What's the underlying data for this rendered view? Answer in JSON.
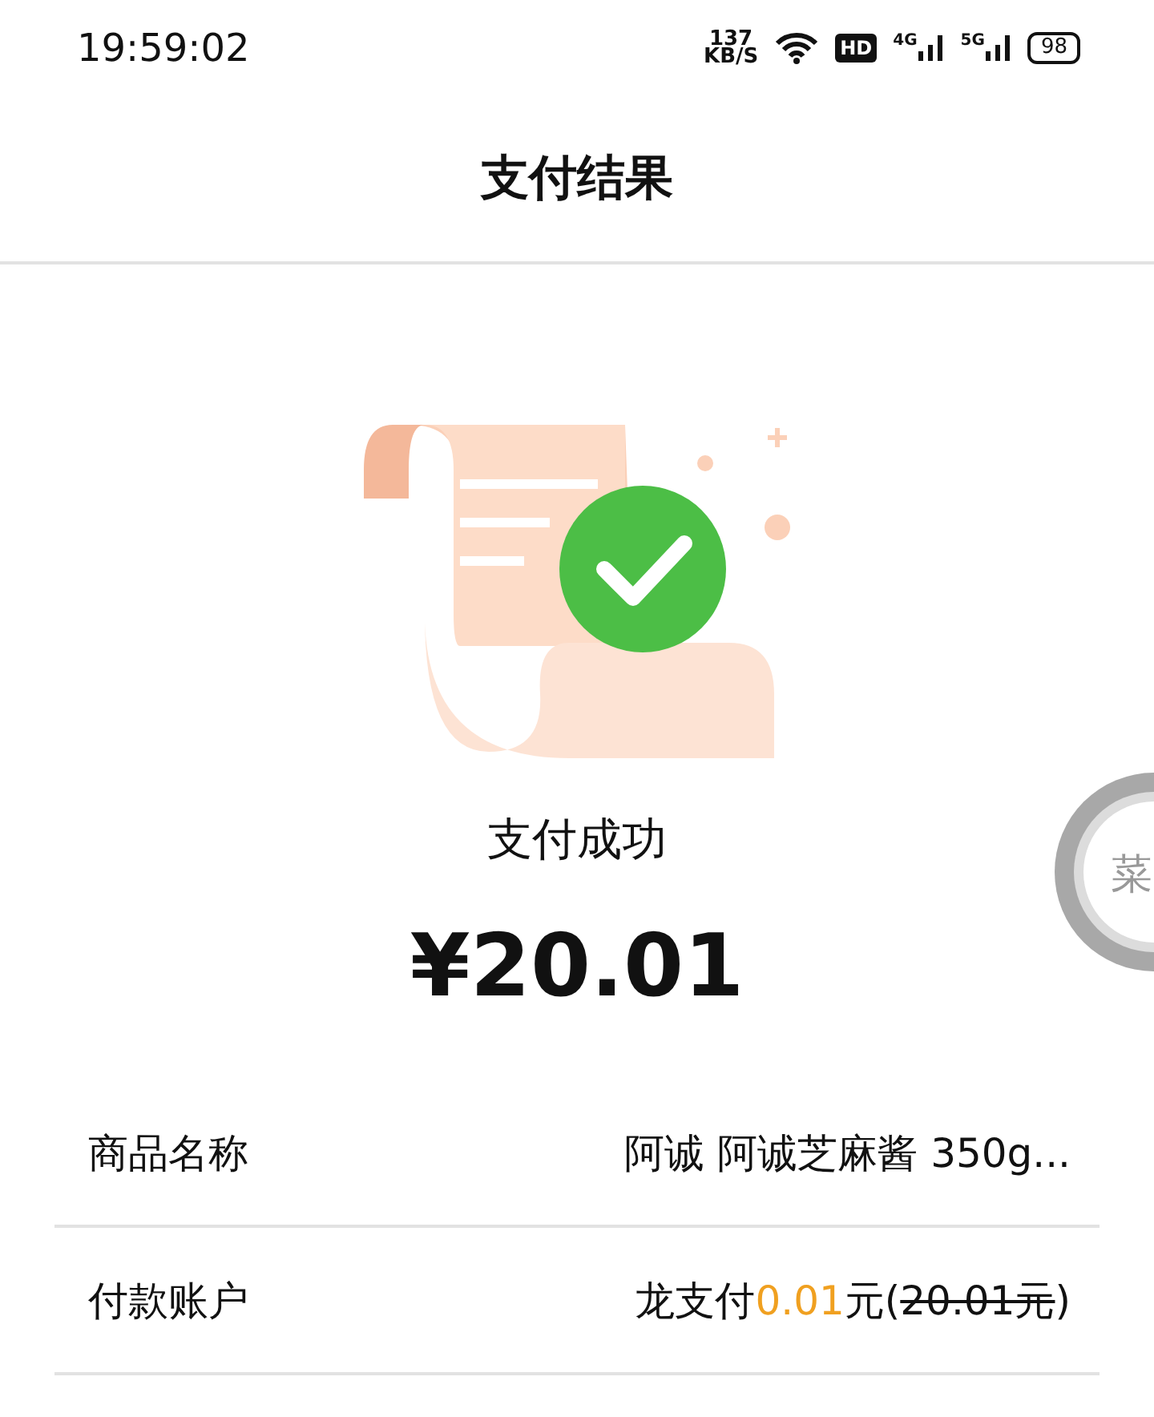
{
  "status_bar": {
    "time": "19:59:02",
    "speed_value": "137",
    "speed_unit": "KB/S",
    "hd_label": "HD",
    "network_4g": "4G",
    "network_5g": "5G",
    "battery": "98"
  },
  "header": {
    "title": "支付结果"
  },
  "result": {
    "status": "支付成功",
    "amount": "¥20.01"
  },
  "floating_button": {
    "label": "菜"
  },
  "details": [
    {
      "label": "商品名称",
      "parts": [
        {
          "kind": "plain",
          "text": "阿诚 阿诚芝麻酱 350g..."
        }
      ]
    },
    {
      "label": "付款账户",
      "parts": [
        {
          "kind": "plain",
          "text": "龙支付"
        },
        {
          "kind": "highlight",
          "text": "0.01"
        },
        {
          "kind": "plain",
          "text": "元("
        },
        {
          "kind": "struck",
          "text": "20.01元"
        },
        {
          "kind": "plain",
          "text": ")"
        }
      ]
    }
  ]
}
